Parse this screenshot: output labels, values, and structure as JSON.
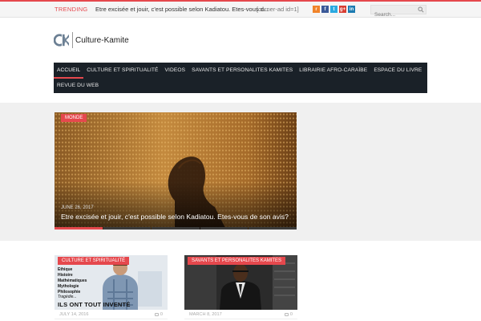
{
  "topbar": {
    "trending_label": "TRENDING",
    "ticker_text": "Etre excisée et jouir, c'est possible selon Kadiatou. Etes-vous d...",
    "shortcode": "[corner-ad id=1]",
    "search_placeholder": "Search...",
    "social_icons": [
      {
        "icon": "rss-icon",
        "glyph": "r",
        "color": "#f0832a"
      },
      {
        "icon": "facebook-icon",
        "glyph": "f",
        "color": "#3b5998"
      },
      {
        "icon": "twitter-icon",
        "glyph": "t",
        "color": "#2aa9e0"
      },
      {
        "icon": "google-plus-icon",
        "glyph": "g+",
        "color": "#d73d32"
      },
      {
        "icon": "linkedin-icon",
        "glyph": "in",
        "color": "#1c7bb1"
      }
    ]
  },
  "logo": {
    "mark": "CK",
    "text": "Culture-Kamite"
  },
  "nav": {
    "row1": [
      "ACCUEIL",
      "CULTURE ET SPIRITUALITÉ",
      "VIDEOS",
      "SAVANTS ET PERSONALITES KAMITES",
      "LIBRAIRIE AFRO-CARAÏBE",
      "ESPACE DU LIVRE"
    ],
    "row2": [
      "REVUE DU WEB"
    ],
    "active": "ACCUEIL"
  },
  "featured": {
    "category": "MONDE",
    "date": "JUNE 26, 2017",
    "title": "Etre excisée et jouir, c'est possible selon Kadiatou. Etes-vous de son avis?",
    "slides": 5,
    "active_slide": 1
  },
  "cards": [
    {
      "category": "CULTURE ET SPIRITUALITÉ",
      "date": "JULY 14, 2016",
      "comments": "0",
      "book_lines": [
        "Ethique",
        "Histoire",
        "Mathématiques",
        "Mythologie",
        "Philosophie",
        "Tragédie..."
      ],
      "book_tagline": "ILS ONT TOUT INVENTÉ"
    },
    {
      "category": "SAVANTS ET PERSONALITES KAMITES",
      "date": "MARCH 8, 2017",
      "comments": "0"
    }
  ],
  "colors": {
    "accent": "#e5484d",
    "nav_bg": "#1a2128",
    "band_bg": "#f0f0f0"
  }
}
